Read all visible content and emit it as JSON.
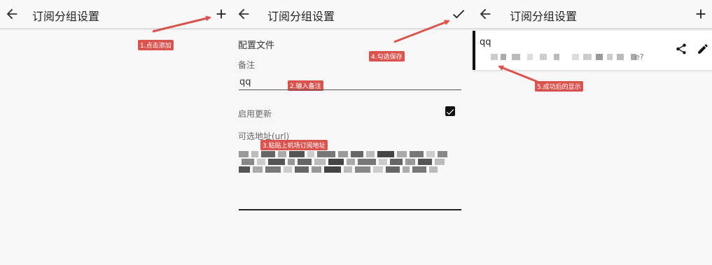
{
  "screens": [
    {
      "title": "订阅分组设置",
      "action_icon": "add-icon",
      "annotation": "1.点击添加"
    },
    {
      "title": "订阅分组设置",
      "action_icon": "check-icon",
      "annotation_save": "4.勾选保存",
      "section_title": "配置文件",
      "remark_label": "备注",
      "remark_value": "qq",
      "annotation_remark": "2.输入备注",
      "enable_update_label": "启用更新",
      "enable_update_checked": true,
      "url_label": "可选地址(url)",
      "annotation_url": "3.粘贴上机场订阅地址"
    },
    {
      "title": "订阅分组设置",
      "action_icon": "add-icon",
      "item_name": "qq",
      "item_url_tail": "e?",
      "annotation": "5.成功后的显示"
    }
  ],
  "colors": {
    "annotation": "#d9534f",
    "arrow": "#d9534f"
  }
}
